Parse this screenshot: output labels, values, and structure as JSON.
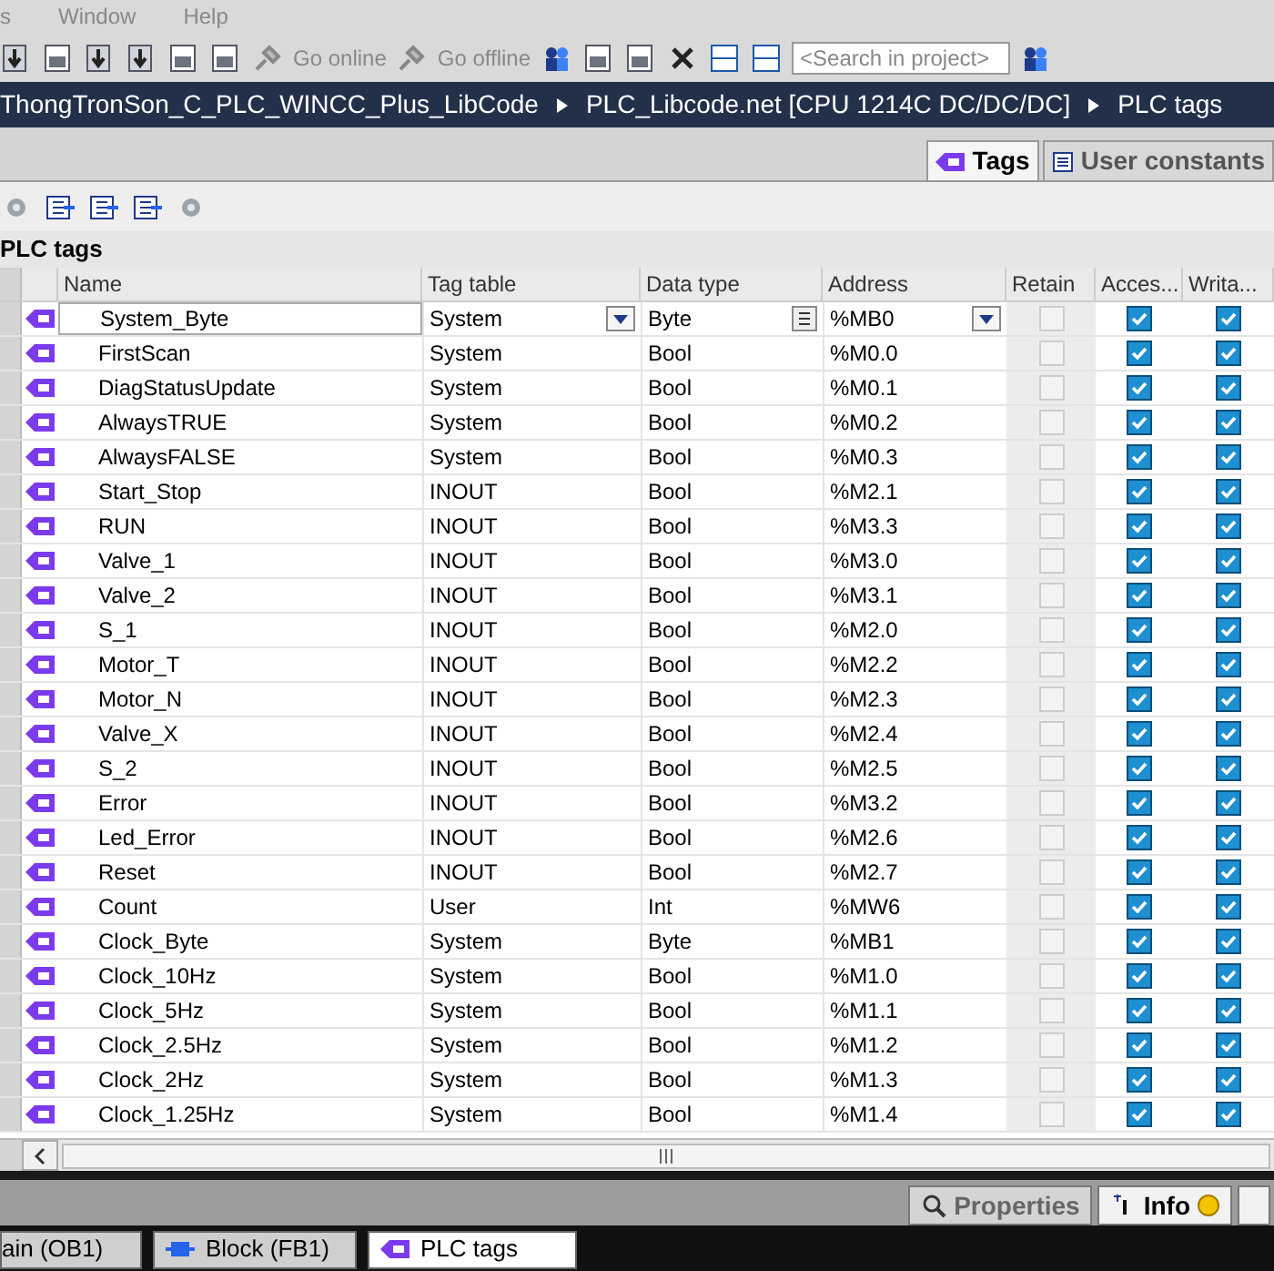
{
  "menu": [
    "s",
    "Window",
    "Help"
  ],
  "toolbar": {
    "go_online": "Go online",
    "go_offline": "Go offline",
    "search": {
      "placeholder": "<Search in project>"
    }
  },
  "breadcrumb": [
    "ThongTronSon_C_PLC_WINCC_Plus_LibCode",
    "PLC_Libcode.net [CPU 1214C DC/DC/DC]",
    "PLC tags"
  ],
  "tabs": [
    {
      "label": "Tags",
      "selected": true
    },
    {
      "label": "User constants",
      "selected": false
    }
  ],
  "table_title": "PLC tags",
  "columns": [
    "Name",
    "Tag table",
    "Data type",
    "Address",
    "Retain",
    "Acces...",
    "Writa..."
  ],
  "rows": [
    {
      "name": "System_Byte",
      "tag_table": "System",
      "data_type": "Byte",
      "address": "%MB0",
      "retain": false,
      "accessible": true,
      "writable": true,
      "selected": true
    },
    {
      "name": "FirstScan",
      "tag_table": "System",
      "data_type": "Bool",
      "address": "%M0.0",
      "retain": false,
      "accessible": true,
      "writable": true,
      "selected": false
    },
    {
      "name": "DiagStatusUpdate",
      "tag_table": "System",
      "data_type": "Bool",
      "address": "%M0.1",
      "retain": false,
      "accessible": true,
      "writable": true,
      "selected": false
    },
    {
      "name": "AlwaysTRUE",
      "tag_table": "System",
      "data_type": "Bool",
      "address": "%M0.2",
      "retain": false,
      "accessible": true,
      "writable": true,
      "selected": false
    },
    {
      "name": "AlwaysFALSE",
      "tag_table": "System",
      "data_type": "Bool",
      "address": "%M0.3",
      "retain": false,
      "accessible": true,
      "writable": true,
      "selected": false
    },
    {
      "name": "Start_Stop",
      "tag_table": "INOUT",
      "data_type": "Bool",
      "address": "%M2.1",
      "retain": false,
      "accessible": true,
      "writable": true,
      "selected": false
    },
    {
      "name": "RUN",
      "tag_table": "INOUT",
      "data_type": "Bool",
      "address": "%M3.3",
      "retain": false,
      "accessible": true,
      "writable": true,
      "selected": false
    },
    {
      "name": "Valve_1",
      "tag_table": "INOUT",
      "data_type": "Bool",
      "address": "%M3.0",
      "retain": false,
      "accessible": true,
      "writable": true,
      "selected": false
    },
    {
      "name": "Valve_2",
      "tag_table": "INOUT",
      "data_type": "Bool",
      "address": "%M3.1",
      "retain": false,
      "accessible": true,
      "writable": true,
      "selected": false
    },
    {
      "name": "S_1",
      "tag_table": "INOUT",
      "data_type": "Bool",
      "address": "%M2.0",
      "retain": false,
      "accessible": true,
      "writable": true,
      "selected": false
    },
    {
      "name": "Motor_T",
      "tag_table": "INOUT",
      "data_type": "Bool",
      "address": "%M2.2",
      "retain": false,
      "accessible": true,
      "writable": true,
      "selected": false
    },
    {
      "name": "Motor_N",
      "tag_table": "INOUT",
      "data_type": "Bool",
      "address": "%M2.3",
      "retain": false,
      "accessible": true,
      "writable": true,
      "selected": false
    },
    {
      "name": "Valve_X",
      "tag_table": "INOUT",
      "data_type": "Bool",
      "address": "%M2.4",
      "retain": false,
      "accessible": true,
      "writable": true,
      "selected": false
    },
    {
      "name": "S_2",
      "tag_table": "INOUT",
      "data_type": "Bool",
      "address": "%M2.5",
      "retain": false,
      "accessible": true,
      "writable": true,
      "selected": false
    },
    {
      "name": "Error",
      "tag_table": "INOUT",
      "data_type": "Bool",
      "address": "%M3.2",
      "retain": false,
      "accessible": true,
      "writable": true,
      "selected": false
    },
    {
      "name": "Led_Error",
      "tag_table": "INOUT",
      "data_type": "Bool",
      "address": "%M2.6",
      "retain": false,
      "accessible": true,
      "writable": true,
      "selected": false
    },
    {
      "name": "Reset",
      "tag_table": "INOUT",
      "data_type": "Bool",
      "address": "%M2.7",
      "retain": false,
      "accessible": true,
      "writable": true,
      "selected": false
    },
    {
      "name": "Count",
      "tag_table": "User",
      "data_type": "Int",
      "address": "%MW6",
      "retain": false,
      "accessible": true,
      "writable": true,
      "selected": false
    },
    {
      "name": "Clock_Byte",
      "tag_table": "System",
      "data_type": "Byte",
      "address": "%MB1",
      "retain": false,
      "accessible": true,
      "writable": true,
      "selected": false
    },
    {
      "name": "Clock_10Hz",
      "tag_table": "System",
      "data_type": "Bool",
      "address": "%M1.0",
      "retain": false,
      "accessible": true,
      "writable": true,
      "selected": false
    },
    {
      "name": "Clock_5Hz",
      "tag_table": "System",
      "data_type": "Bool",
      "address": "%M1.1",
      "retain": false,
      "accessible": true,
      "writable": true,
      "selected": false
    },
    {
      "name": "Clock_2.5Hz",
      "tag_table": "System",
      "data_type": "Bool",
      "address": "%M1.2",
      "retain": false,
      "accessible": true,
      "writable": true,
      "selected": false
    },
    {
      "name": "Clock_2Hz",
      "tag_table": "System",
      "data_type": "Bool",
      "address": "%M1.3",
      "retain": false,
      "accessible": true,
      "writable": true,
      "selected": false
    },
    {
      "name": "Clock_1.25Hz",
      "tag_table": "System",
      "data_type": "Bool",
      "address": "%M1.4",
      "retain": false,
      "accessible": true,
      "writable": true,
      "selected": false
    }
  ],
  "inspector_tabs": [
    {
      "label": "Properties",
      "selected": false
    },
    {
      "label": "Info",
      "selected": true
    }
  ],
  "taskbar": [
    {
      "label": "ain (OB1)",
      "selected": false
    },
    {
      "label": "Block (FB1)",
      "selected": false
    },
    {
      "label": "PLC tags",
      "selected": true
    }
  ]
}
